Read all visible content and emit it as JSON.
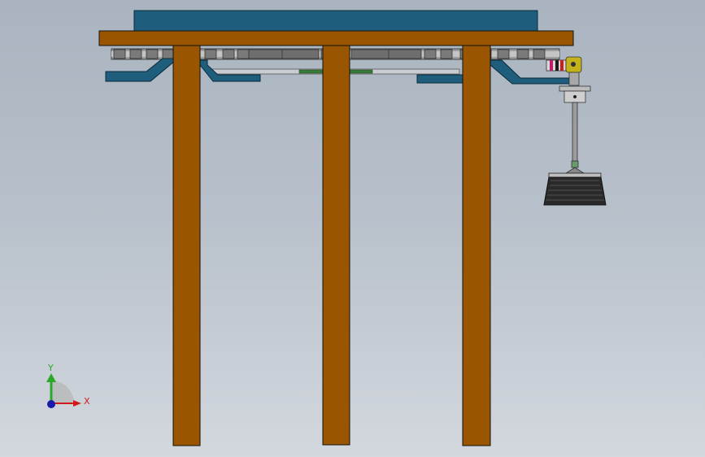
{
  "viewport": {
    "description_colors": {
      "background_top": "#a9b4c0",
      "background_bottom": "#d3d8de",
      "wood": "#9a5500",
      "wood_edge": "#000000",
      "blue_panel": "#1e5d7c",
      "chain_grey": "#8c8c8c",
      "green_strip": "#3a7a3a",
      "axis_x": "#d11b1b",
      "axis_y": "#2aa82a",
      "axis_origin": "#1a1aa8"
    }
  },
  "triad": {
    "x_label": "X",
    "y_label": "Y",
    "x_icon": "x-axis-arrow-icon",
    "y_icon": "y-axis-arrow-icon",
    "origin_icon": "origin-sphere-icon"
  }
}
